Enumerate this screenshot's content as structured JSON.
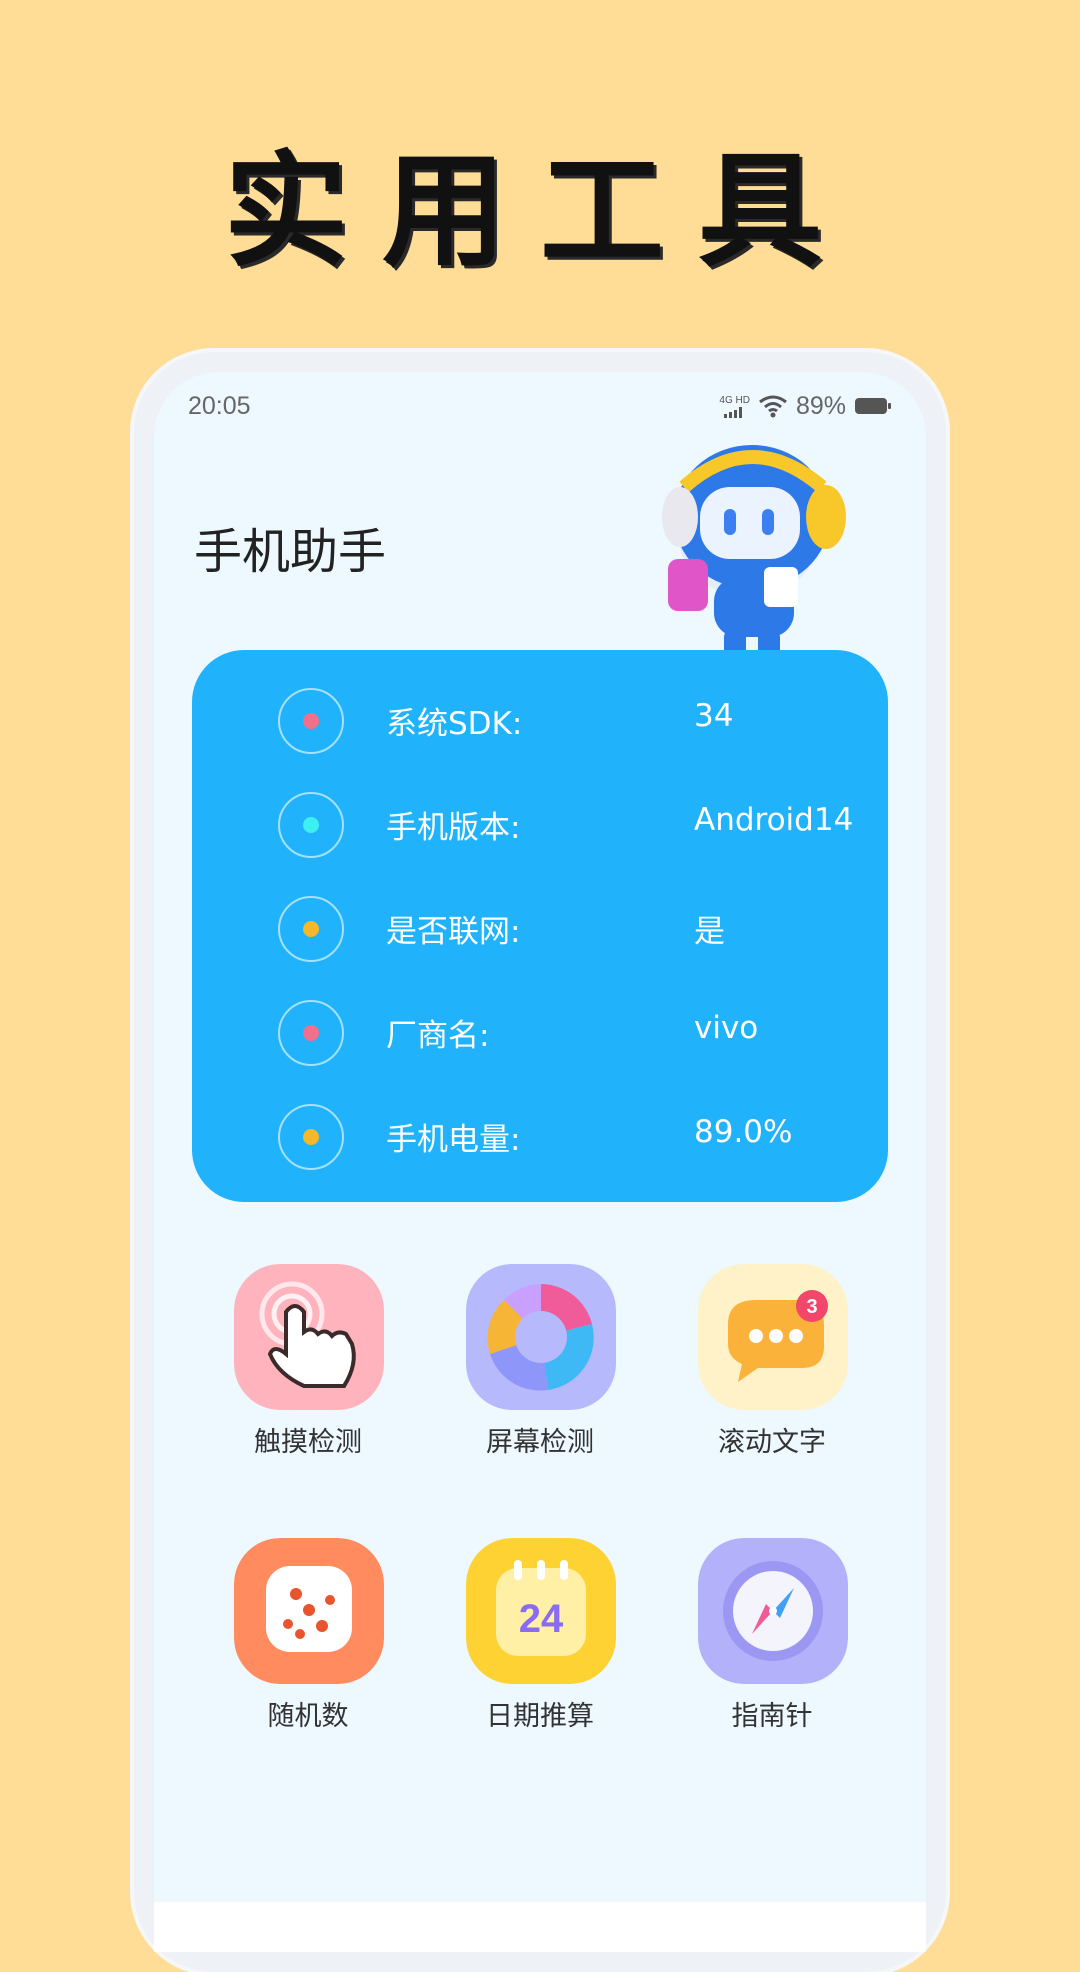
{
  "promo": {
    "title": "实用工具"
  },
  "status_bar": {
    "time": "20:05",
    "network_label_top": "4G HD",
    "battery_percent_text": "89%",
    "icons": [
      "signal-icon",
      "wifi-icon",
      "battery-icon"
    ]
  },
  "app": {
    "title": "手机助手"
  },
  "info_card": {
    "rows": [
      {
        "label": "系统SDK:",
        "value": "34",
        "dot_color": "#F2708C"
      },
      {
        "label": "手机版本:",
        "value": "Android14",
        "dot_color": "#3DF0F0"
      },
      {
        "label": "是否联网:",
        "value": "是",
        "dot_color": "#F5B82A"
      },
      {
        "label": "厂商名:",
        "value": "vivo",
        "dot_color": "#F2708C"
      },
      {
        "label": "手机电量:",
        "value": "89.0%",
        "dot_color": "#F5B82A"
      }
    ]
  },
  "tools": [
    {
      "label": "触摸检测",
      "icon": "touch-hand-icon",
      "bg": "#FFB3BC"
    },
    {
      "label": "屏幕检测",
      "icon": "screen-pie-icon",
      "bg": "#B6B9FB"
    },
    {
      "label": "滚动文字",
      "icon": "chat-bubble-icon",
      "bg": "#FFF2C8",
      "badge": "3"
    },
    {
      "label": "随机数",
      "icon": "dice-icon",
      "bg": "#FF8B5E"
    },
    {
      "label": "日期推算",
      "icon": "calendar-icon",
      "bg": "#FFD233",
      "calendar_day": "24"
    },
    {
      "label": "指南针",
      "icon": "compass-icon",
      "bg": "#B3B1FA"
    }
  ]
}
